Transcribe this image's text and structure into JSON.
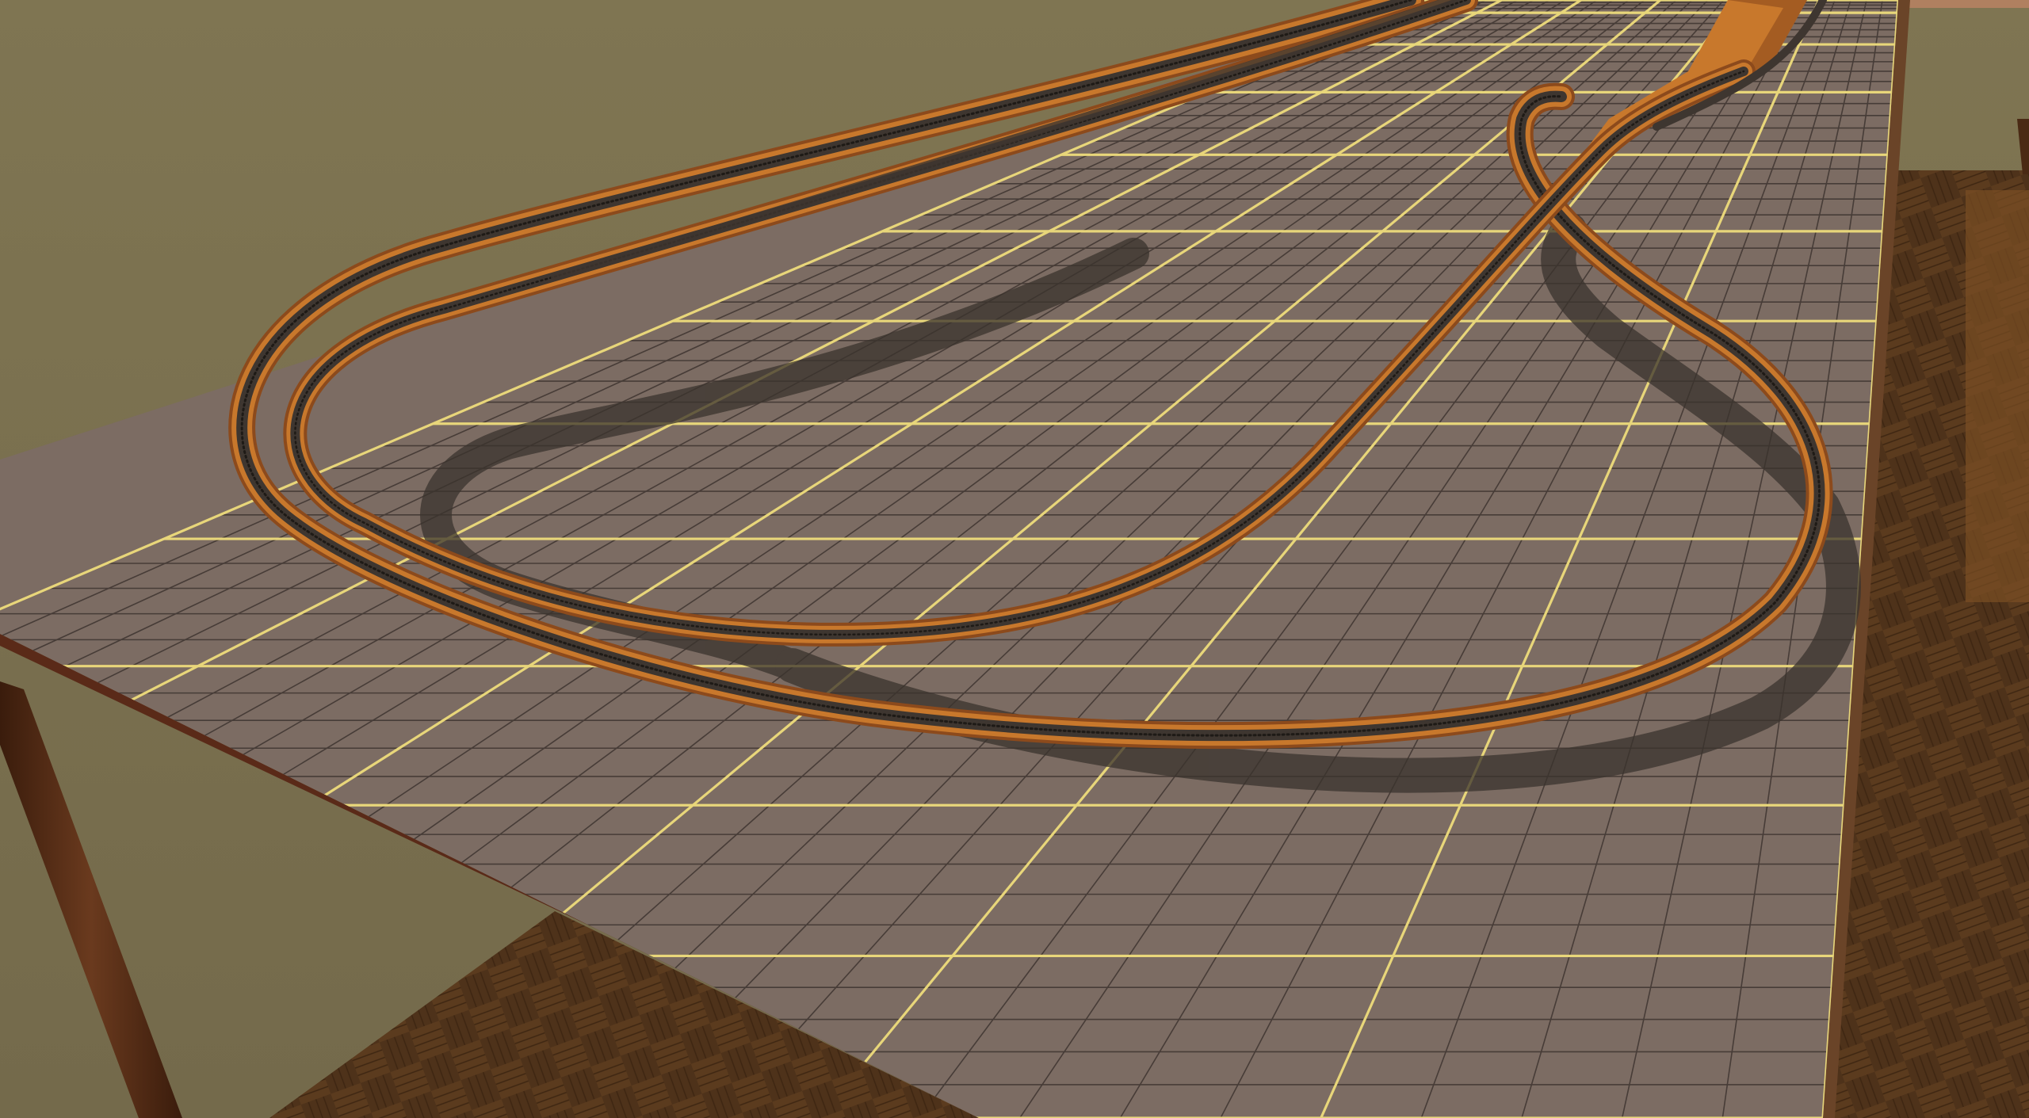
{
  "scene": {
    "description_tag": "",
    "colors": {
      "wall": "#7d7351",
      "board": "#7c6c63",
      "board_edge": "#5a2a18",
      "grid_major": "#e8d67a",
      "grid_minor": "#3e3430",
      "roadbed": "#c8782c",
      "roadbed_dark": "#8c4a1c",
      "track": "#3e3630",
      "floor": "#4a3018",
      "leg": "#5a3018",
      "shadow": "#3a332d"
    },
    "icons": [
      "table-leg",
      "floor-parquet",
      "track-loop"
    ]
  }
}
